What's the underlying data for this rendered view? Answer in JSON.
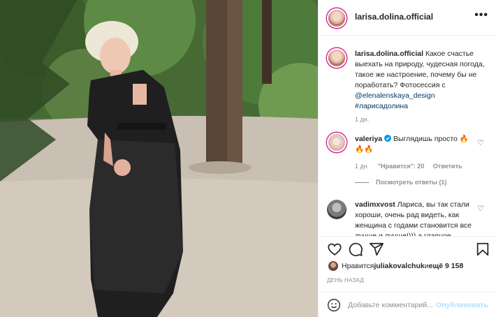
{
  "photo": {
    "description_icon": "photo-woman-in-forest"
  },
  "header": {
    "username": "larisa.dolina.official",
    "more_icon": "more-horizontal-icon",
    "more_label": "•••"
  },
  "caption": {
    "username": "larisa.dolina.official",
    "text_before": " Какое счастье выехать на природу, чудесная погода, такое же настроение, почему бы не поработать? Фотосессия с ",
    "mention": "@elenalenskaya_design",
    "hashtag": "#ларисадолина",
    "time": "1 дн."
  },
  "comments": [
    {
      "username": "valeriya",
      "verified": true,
      "text": "Выглядишь просто 🔥🔥🔥",
      "time": "1 дн.",
      "likes": "\"Нравится\": 20",
      "reply": "Ответить",
      "view_replies": "Посмотреть ответы (1)"
    },
    {
      "username": "vadimxvost",
      "text": "Лариса, вы так стали хороши, очень рад видеть, как женщина с годами становится все лучше и лучше!))) а главное"
    }
  ],
  "actions": {
    "like_icon": "heart-icon",
    "comment_icon": "comment-icon",
    "share_icon": "send-icon",
    "save_icon": "bookmark-icon"
  },
  "likes": {
    "prefix": "Нравится ",
    "user": "juliakovalchuk",
    "middle": " и ",
    "rest": "ещё 9 158"
  },
  "time_ago": "ДЕНЬ НАЗАД",
  "comment_box": {
    "placeholder": "Добавьте комментарий...",
    "post_label": "Опубликовать"
  },
  "colors": {
    "text": "#262626",
    "muted": "#8e8e8e",
    "link": "#00376b",
    "post_disabled": "#b2dffc",
    "verified": "#0095f6",
    "story_ring": "#d6249f"
  }
}
